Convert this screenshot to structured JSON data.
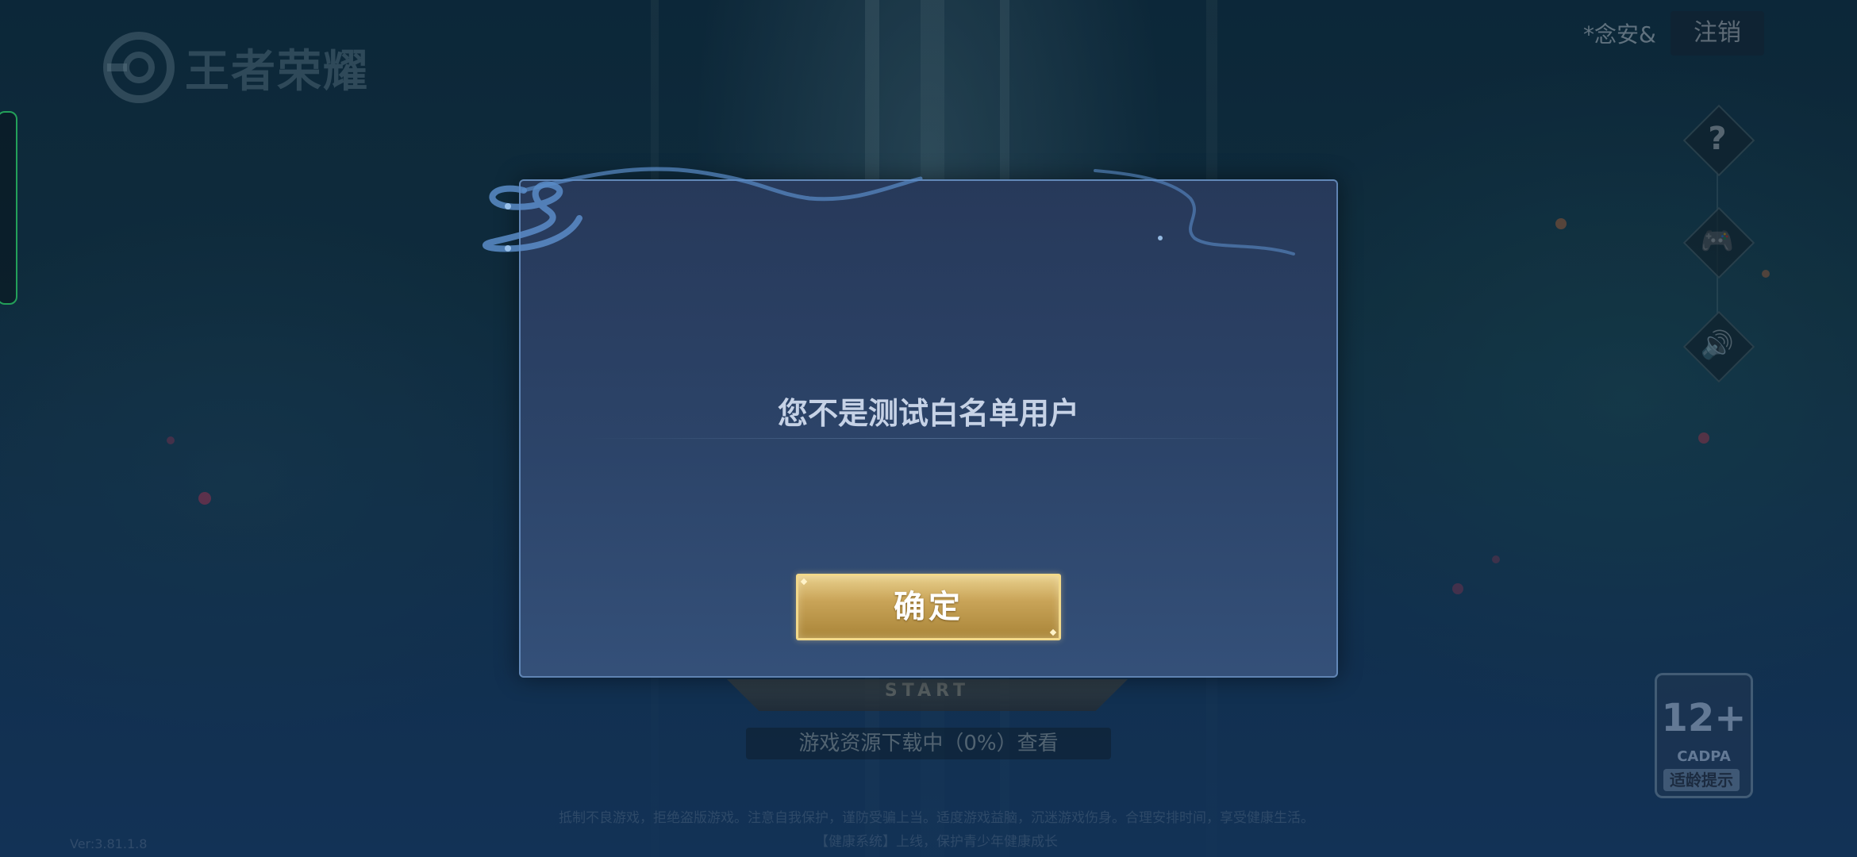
{
  "game": {
    "logo_text": "王者荣耀"
  },
  "account": {
    "username": "*念安&",
    "logout_label": "注销"
  },
  "side_buttons": [
    {
      "icon": "help-icon",
      "glyph": "?"
    },
    {
      "icon": "gamepad-icon",
      "glyph": "🎮"
    },
    {
      "icon": "speaker-icon",
      "glyph": "🔊"
    }
  ],
  "age_rating": {
    "age": "12+",
    "org": "CADPA",
    "hint": "适龄提示"
  },
  "start": {
    "label": "START"
  },
  "download": {
    "status": "游戏资源下载中（0%）查看"
  },
  "footer": {
    "line1": "抵制不良游戏，拒绝盗版游戏。注意自我保护，谨防受骗上当。适度游戏益脑，沉迷游戏伤身。合理安排时间，享受健康生活。",
    "line2": "【健康系统】上线，保护青少年健康成长",
    "version": "Ver:3.81.1.8"
  },
  "dialog": {
    "message": "您不是测试白名单用户",
    "confirm_label": "确定"
  }
}
